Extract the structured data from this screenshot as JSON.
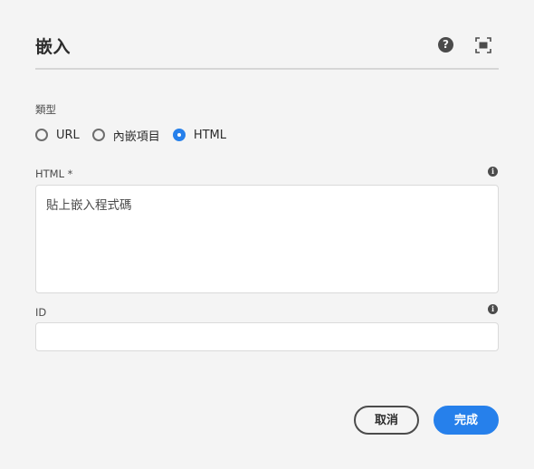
{
  "dialog": {
    "title": "嵌入",
    "help_icon": "help-circle-icon",
    "fullscreen_icon": "fullscreen-icon"
  },
  "type_field": {
    "label": "類型",
    "options": [
      {
        "label": "URL",
        "checked": false
      },
      {
        "label": "內嵌項目",
        "checked": false
      },
      {
        "label": "HTML",
        "checked": true
      }
    ]
  },
  "html_field": {
    "label": "HTML *",
    "placeholder": "貼上嵌入程式碼",
    "value": ""
  },
  "id_field": {
    "label": "ID",
    "value": ""
  },
  "buttons": {
    "cancel": "取消",
    "done": "完成"
  },
  "colors": {
    "accent": "#2680eb",
    "background": "#f4f4f4",
    "text": "#2c2c2c"
  }
}
